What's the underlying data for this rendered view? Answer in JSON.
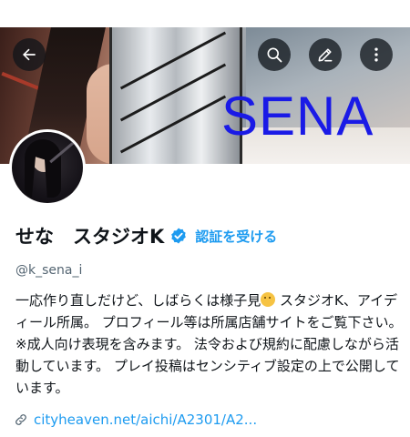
{
  "banner": {
    "overlay_text": "SENA"
  },
  "header_buttons": {
    "back": "arrow-left-icon",
    "search": "search-icon",
    "edit": "pencil-icon",
    "more": "more-vertical-icon"
  },
  "profile": {
    "display_name": "せな　スタジオK",
    "verify_label": "認証を受ける",
    "handle": "@k_sena_i",
    "bio_part1": "一応作り直しだけど、しばらくは様子見",
    "bio_emoji": "thinking-face-icon",
    "bio_part2": " スタジオK、アイディール所属。 プロフィール等は所属店舗サイトをご覧下さい。 ※成人向け表現を含みます。 法令および規約に配慮しながら活動しています。 プレイ投稿はセンシティブ設定の上で公開しています。",
    "link_text": "cityheaven.net/aichi/A2301/A2..."
  },
  "colors": {
    "accent": "#1d9bf0",
    "overlay_text": "#1a1ae6",
    "muted": "#536471"
  }
}
